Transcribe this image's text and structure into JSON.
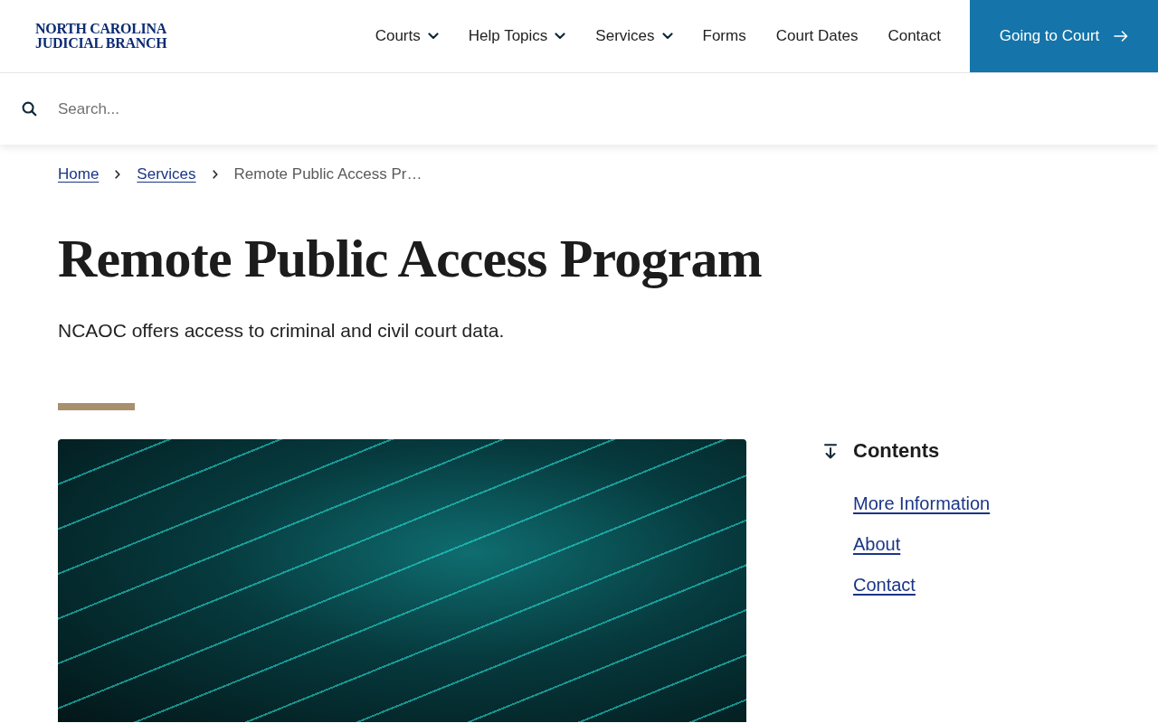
{
  "header": {
    "logo": {
      "line_1": "NORTH CAROLINA",
      "line_2": "JUDICIAL BRANCH"
    },
    "nav": [
      {
        "label": "Courts",
        "dropdown": true
      },
      {
        "label": "Help Topics",
        "dropdown": true
      },
      {
        "label": "Services",
        "dropdown": true
      },
      {
        "label": "Forms",
        "dropdown": false
      },
      {
        "label": "Court Dates",
        "dropdown": false
      },
      {
        "label": "Contact",
        "dropdown": false
      }
    ],
    "cta": {
      "label": "Going to Court"
    }
  },
  "search": {
    "placeholder": "Search..."
  },
  "breadcrumb": [
    {
      "label": "Home",
      "kind": "link"
    },
    {
      "label": "Services",
      "kind": "link"
    },
    {
      "label": "Remote Public Access Pr…",
      "kind": "current"
    }
  ],
  "page": {
    "title": "Remote Public Access Program",
    "intro": "NCAOC offers access to criminal and civil court data."
  },
  "contents": {
    "title": "Contents",
    "links": [
      "More Information",
      "About",
      "Contact"
    ]
  }
}
